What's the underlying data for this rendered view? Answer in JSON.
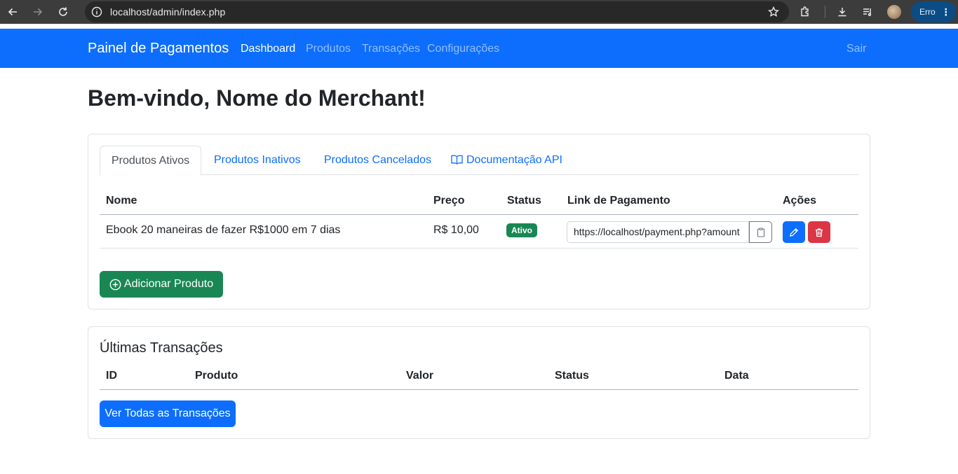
{
  "browser": {
    "url": "localhost/admin/index.php",
    "profile_label": "Erro"
  },
  "navbar": {
    "brand": "Painel de Pagamentos",
    "links": [
      "Dashboard",
      "Produtos",
      "Transações",
      "Configurações"
    ],
    "active": "Dashboard",
    "logout": "Sair"
  },
  "welcome": "Bem-vindo, Nome do Merchant!",
  "products_card": {
    "tabs": [
      "Produtos Ativos",
      "Produtos Inativos",
      "Produtos Cancelados",
      "Documentação API"
    ],
    "active_tab": "Produtos Ativos",
    "headers": [
      "Nome",
      "Preço",
      "Status",
      "Link de Pagamento",
      "Ações"
    ],
    "rows": [
      {
        "name": "Ebook 20 maneiras de fazer R$1000 em 7 dias",
        "price": "R$ 10,00",
        "status": "Ativo",
        "link": "https://localhost/payment.php?amount"
      }
    ],
    "add_button": "Adicionar Produto"
  },
  "transactions_card": {
    "title": "Últimas Transações",
    "headers": [
      "ID",
      "Produto",
      "Valor",
      "Status",
      "Data"
    ],
    "view_all_button": "Ver Todas as Transações"
  },
  "colors": {
    "primary": "#0d6efd",
    "success": "#198754",
    "danger": "#dc3545"
  }
}
